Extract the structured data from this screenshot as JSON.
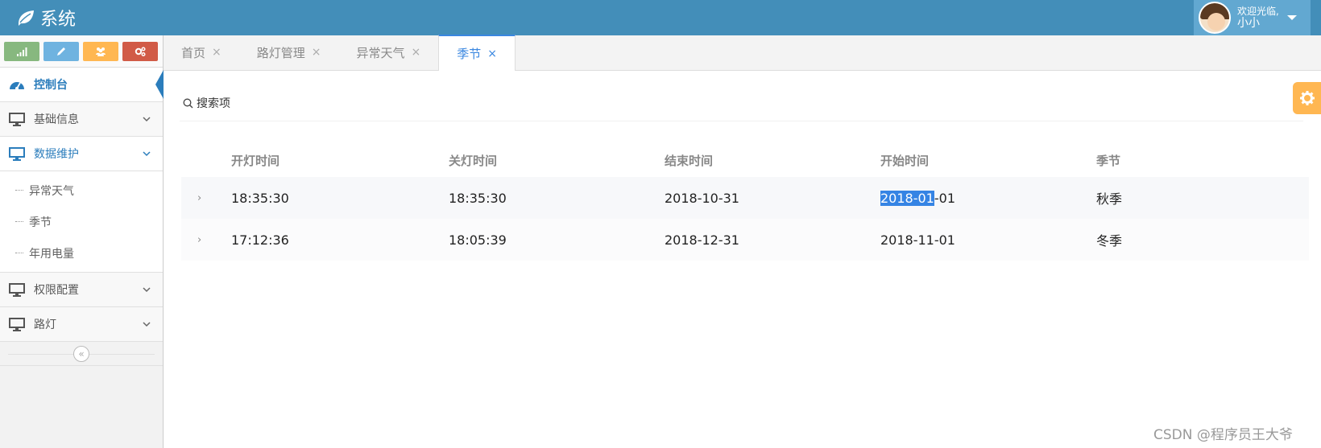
{
  "header": {
    "title": "系统",
    "user": {
      "welcome": "欢迎光临,",
      "name": "小小"
    }
  },
  "sidebar": {
    "items": [
      {
        "label": "控制台"
      },
      {
        "label": "基础信息"
      },
      {
        "label": "数据维护",
        "children": [
          {
            "label": "异常天气"
          },
          {
            "label": "季节"
          },
          {
            "label": "年用电量"
          }
        ]
      },
      {
        "label": "权限配置"
      },
      {
        "label": "路灯"
      }
    ],
    "collapse_glyph": "«"
  },
  "tabs": [
    {
      "label": "首页",
      "close": "×"
    },
    {
      "label": "路灯管理",
      "close": "×"
    },
    {
      "label": "异常天气",
      "close": "×"
    },
    {
      "label": "季节",
      "close": "×"
    }
  ],
  "search": {
    "label": "搜索项"
  },
  "table": {
    "columns": [
      "开灯时间",
      "关灯时间",
      "结束时间",
      "开始时间",
      "季节"
    ],
    "expander": "›",
    "rows": [
      {
        "on": "18:35:30",
        "off": "18:35:30",
        "end": "2018-10-31",
        "start_sel": "2018-01",
        "start_rest": "-01",
        "season": "秋季"
      },
      {
        "on": "17:12:36",
        "off": "18:05:39",
        "end": "2018-12-31",
        "start_sel": "",
        "start_rest": "2018-11-01",
        "season": "冬季"
      }
    ]
  },
  "watermark": "CSDN @程序员王大爷",
  "colors": {
    "header": "#438eb9",
    "accent": "#2b7dbc",
    "tab_active": "#3a87e0",
    "settings": "#ffb752"
  },
  "icons": [
    "leaf-icon",
    "signal-icon",
    "pencil-icon",
    "users-icon",
    "cogs-icon",
    "dashboard-icon",
    "desktop-icon",
    "chevron-down-icon",
    "search-icon",
    "gear-icon"
  ]
}
